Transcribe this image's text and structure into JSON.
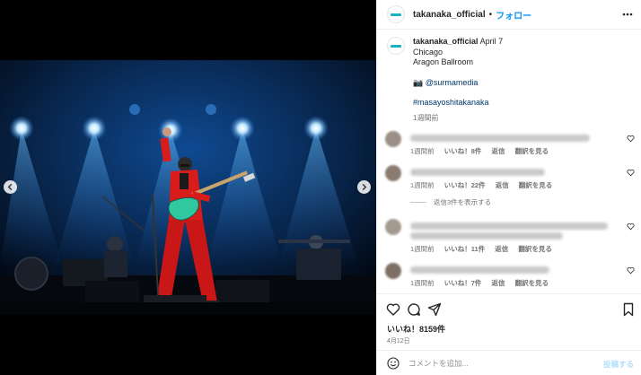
{
  "post": {
    "username": "takanaka_official",
    "follow_label": "フォロー",
    "separator": "•",
    "caption": {
      "username": "takanaka_official",
      "date_text": "April 7",
      "line1": "Chicago",
      "line2": "Aragon Ballroom",
      "camera_emoji": "📷",
      "credit": "@surmamedia",
      "hashtag": "#masayoshitakanaka",
      "time": "1週間前"
    },
    "comments": [
      {
        "time": "1週間前",
        "likes": "いいね！8件",
        "reply": "返信",
        "translate": "翻訳を見る"
      },
      {
        "time": "1週間前",
        "likes": "いいね！22件",
        "reply": "返信",
        "translate": "翻訳を見る"
      },
      {
        "time": "1週間前",
        "likes": "いいね！11件",
        "reply": "返信",
        "translate": "翻訳を見る"
      },
      {
        "time": "1週間前",
        "likes": "いいね！7件",
        "reply": "返信",
        "translate": "翻訳を見る"
      }
    ],
    "replies_toggle": "返信3件を表示する",
    "likes_total": "いいね！8159件",
    "post_date": "4月12日"
  },
  "composer": {
    "placeholder": "コメントを追加...",
    "post_label": "投稿する"
  },
  "colors": {
    "accent": "#0095f6",
    "stage_blue": "#0b3f86",
    "suit_red": "#d81b1b",
    "guitar": "#2fc8a0"
  }
}
